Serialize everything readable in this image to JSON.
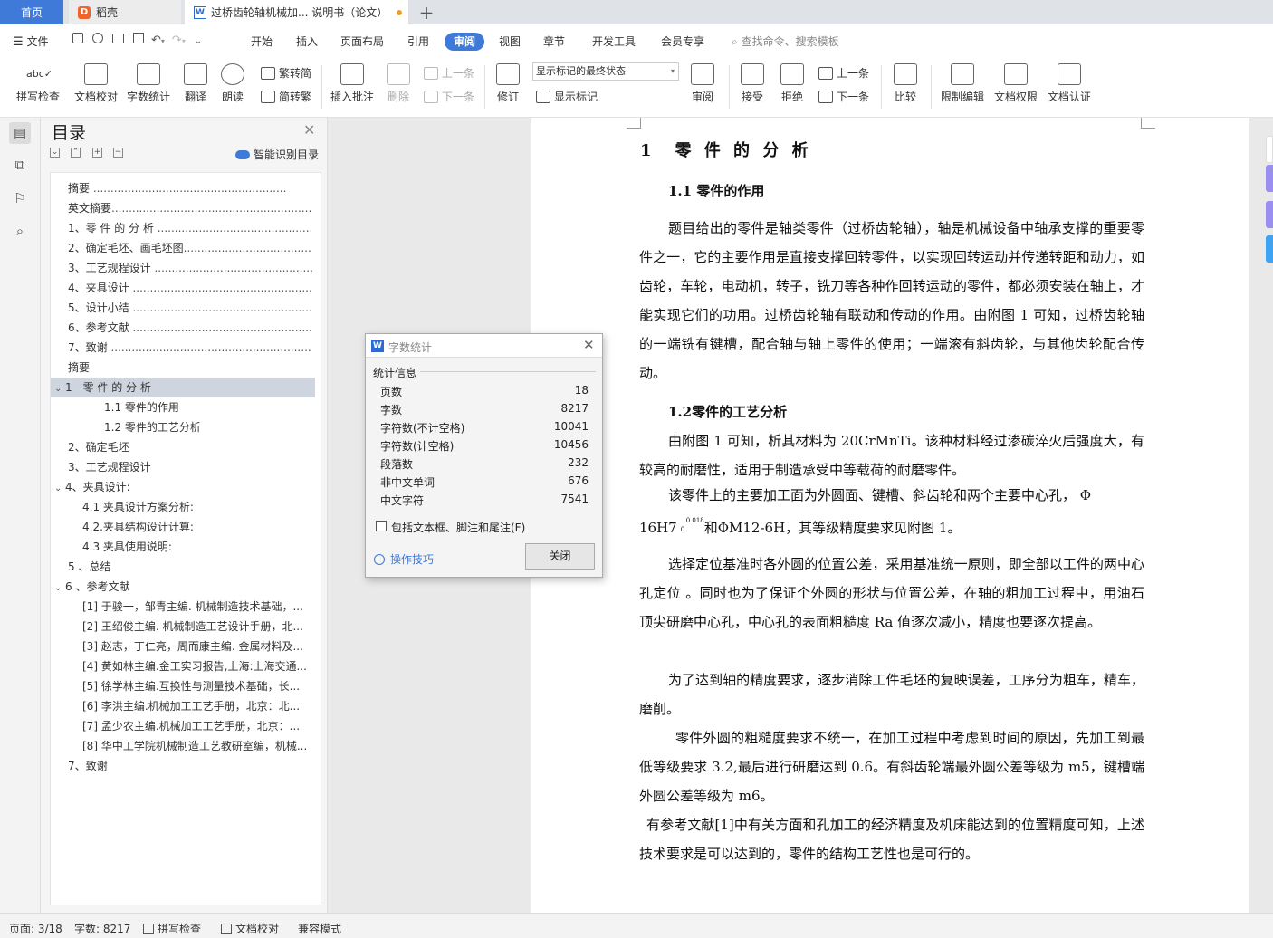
{
  "tabs": {
    "home": "首页",
    "daoke": "稻壳",
    "document": "过桥齿轮轴机械加... 说明书（论文）",
    "add": "+"
  },
  "menubar": {
    "file": "文件",
    "items": [
      "开始",
      "插入",
      "页面布局",
      "引用",
      "审阅",
      "视图",
      "章节",
      "开发工具",
      "会员专享"
    ],
    "active": "审阅",
    "search_placeholder": "查找命令、搜索模板"
  },
  "ribbon": {
    "spellcheck": "拼写检查",
    "doc_proof": "文档校对",
    "word_count": "字数统计",
    "translate": "翻译",
    "read_aloud": "朗读",
    "trad_simplified": "繁转简",
    "simp_traditional": "简转繁",
    "insert_comment": "插入批注",
    "delete": "删除",
    "prev_comment": "上一条",
    "next_comment": "下一条",
    "revise": "修订",
    "mark_state": "显示标记的最终状态",
    "show_marks": "显示标记",
    "review": "审阅",
    "accept": "接受",
    "reject": "拒绝",
    "prev_change": "上一条",
    "next_change": "下一条",
    "compare": "比较",
    "restrict_edit": "限制编辑",
    "doc_rights": "文档权限",
    "doc_cert": "文档认证"
  },
  "toc": {
    "title": "目录",
    "smart": "智能识别目录",
    "items": [
      {
        "text": "摘要",
        "lead": " ........................................................"
      },
      {
        "text": "英文摘要",
        "lead": "..........................................................."
      },
      {
        "text": "1、零 件 的 分 析",
        "lead": " ........................................................"
      },
      {
        "text": "2、确定毛坯、画毛坯图",
        "lead": "................................................."
      },
      {
        "text": "3、工艺规程设计",
        "lead": " ........................................................"
      },
      {
        "text": "4、夹具设计",
        "lead": " ..............................................................."
      },
      {
        "text": "5、设计小结",
        "lead": " ..............................................................."
      },
      {
        "text": "6、参考文献",
        "lead": "  ............................................................"
      },
      {
        "text": "7、致谢",
        "lead": " ......................................................................."
      },
      {
        "text": "摘要",
        "lead": ""
      },
      {
        "text": "1　零 件 的 分 析",
        "lead": ""
      },
      {
        "text": "1.1 零件的作用",
        "lead": ""
      },
      {
        "text": "1.2 零件的工艺分析",
        "lead": ""
      },
      {
        "text": "2、确定毛坯",
        "lead": ""
      },
      {
        "text": "3、工艺规程设计",
        "lead": ""
      },
      {
        "text": "4、夹具设计:",
        "lead": ""
      },
      {
        "text": "4.1 夹具设计方案分析:",
        "lead": ""
      },
      {
        "text": "4.2.夹具结构设计计算:",
        "lead": ""
      },
      {
        "text": "4.3 夹具使用说明:",
        "lead": ""
      },
      {
        "text": "5 、总结",
        "lead": ""
      },
      {
        "text": "6 、参考文献",
        "lead": ""
      },
      {
        "text": "[1] 于骏一，邹青主编. 机械制造技术基础，...",
        "lead": ""
      },
      {
        "text": "[2] 王绍俊主编. 机械制造工艺设计手册，北...",
        "lead": ""
      },
      {
        "text": "[3] 赵志，丁仁亮，周而康主编. 金属材料及...",
        "lead": ""
      },
      {
        "text": "[4] 黄如林主编.金工实习报告,上海:上海交通...",
        "lead": ""
      },
      {
        "text": "[5] 徐学林主编.互换性与测量技术基础，长...",
        "lead": ""
      },
      {
        "text": "[6] 李洪主编.机械加工工艺手册，北京：北...",
        "lead": ""
      },
      {
        "text": "[7] 孟少农主编.机械加工工艺手册，北京：...",
        "lead": ""
      },
      {
        "text": "[8] 华中工学院机械制造工艺教研室编，机械...",
        "lead": ""
      },
      {
        "text": "7、致谢",
        "lead": ""
      }
    ]
  },
  "dialog": {
    "title": "字数统计",
    "section": "统计信息",
    "stats": [
      {
        "label": "页数",
        "value": "18"
      },
      {
        "label": "字数",
        "value": "8217"
      },
      {
        "label": "字符数(不计空格)",
        "value": "10041"
      },
      {
        "label": "字符数(计空格)",
        "value": "10456"
      },
      {
        "label": "段落数",
        "value": "232"
      },
      {
        "label": "非中文单词",
        "value": "676"
      },
      {
        "label": "中文字符",
        "value": "7541"
      }
    ],
    "checkbox": "包括文本框、脚注和尾注(F)",
    "tips": "操作技巧",
    "close": "关闭"
  },
  "document": {
    "h1": "1　零 件 的 分 析",
    "h2a": "1.1 零件的作用",
    "p1": "题目给出的零件是轴类零件（过桥齿轮轴），轴是机械设备中轴承支撑的重要零件之一，它的主要作用是直接支撑回转零件，以实现回转运动并传递转距和动力，如齿轮，车轮，电动机，转子，铣刀等各种作回转运动的零件，都必须安装在轴上，才能实现它们的功用。过桥齿轮轴有联动和传动的作用。由附图 1 可知，过桥齿轮轴的一端铣有键槽，配合轴与轴上零件的使用；一端滚有斜齿轮，与其他齿轮配合传动。",
    "h2b": "1.2零件的工艺分析",
    "p2": "由附图 1 可知，析其材料为 20CrMnTi。该种材料经过渗碳淬火后强度大，有较高的耐磨性，适用于制造承受中等载荷的耐磨零件。",
    "p3a": "该零件上的主要加工面为外圆面、键槽、斜齿轮和两个主要中心孔， Φ",
    "p3b": "16H7",
    "p3sup": "0.018",
    "p3sub": "0",
    "p3c": "和ΦM12-6H，其等级精度要求见附图 1。",
    "p4": "选择定位基准时各外圆的位置公差，采用基准统一原则，即全部以工件的两中心孔定位 。同时也为了保证个外圆的形状与位置公差，在轴的粗加工过程中，用油石顶尖研磨中心孔，中心孔的表面粗糙度 Ra 值逐次减小，精度也要逐次提高。",
    "p5": "为了达到轴的精度要求，逐步消除工件毛坯的复映误差，工序分为粗车，精车，磨削。",
    "p6": "零件外圆的粗糙度要求不统一，在加工过程中考虑到时间的原因，先加工到最低等级要求 3.2,最后进行研磨达到 0.6。有斜齿轮端最外圆公差等级为 m5，键槽端外圆公差等级为 m6。",
    "p7": "有参考文献[1]中有关方面和孔加工的经济精度及机床能达到的位置精度可知，上述技术要求是可以达到的，零件的结构工艺性也是可行的。"
  },
  "status": {
    "page": "页面: 3/18",
    "words": "字数: 8217",
    "spell": "拼写检查",
    "proof": "文档校对",
    "compat": "兼容模式"
  },
  "colors": {
    "accent": "#3f7ad9",
    "selection": "#cfd5de"
  }
}
